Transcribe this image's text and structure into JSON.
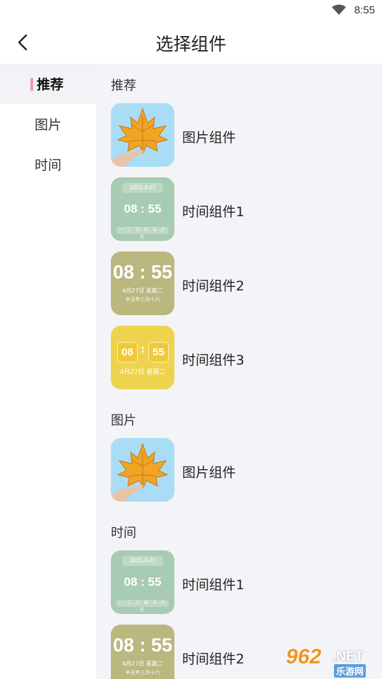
{
  "status_bar": {
    "time": "8:55"
  },
  "header": {
    "title": "选择组件"
  },
  "sidebar": {
    "items": [
      {
        "label": "推荐",
        "active": true
      },
      {
        "label": "图片",
        "active": false
      },
      {
        "label": "时间",
        "active": false
      }
    ]
  },
  "sections": [
    {
      "title": "推荐",
      "widgets": [
        {
          "label": "图片组件"
        },
        {
          "label": "时间组件1",
          "preview": {
            "date": "2021-4-27",
            "clock": "08 : 55",
            "week": "一 二 三 四 五 六 日"
          }
        },
        {
          "label": "时间组件2",
          "preview": {
            "clock": "08 : 55",
            "line1": "4月27日 星期二",
            "line2": "辛丑年三月十六"
          }
        },
        {
          "label": "时间组件3",
          "preview": {
            "hour": "08",
            "colon": ":",
            "minute": "55",
            "line1": "4月27日 星期二"
          }
        }
      ]
    },
    {
      "title": "图片",
      "widgets": [
        {
          "label": "图片组件"
        }
      ]
    },
    {
      "title": "时间",
      "widgets": [
        {
          "label": "时间组件1",
          "preview": {
            "date": "2021-4-27",
            "clock": "08 : 55",
            "week": "一 二 三 四 五 六 日"
          }
        },
        {
          "label": "时间组件2",
          "preview": {
            "clock": "08 : 55",
            "line1": "4月27日 星期二",
            "line2": "辛丑年三月十六"
          }
        }
      ]
    }
  ],
  "watermark": {
    "number": "962",
    "net": ".NET",
    "sub": "乐游网"
  },
  "colors": {
    "accent": "#f39ab5",
    "sidebar_active_bg": "#f2f3f6",
    "content_bg": "#f3f4f7"
  }
}
